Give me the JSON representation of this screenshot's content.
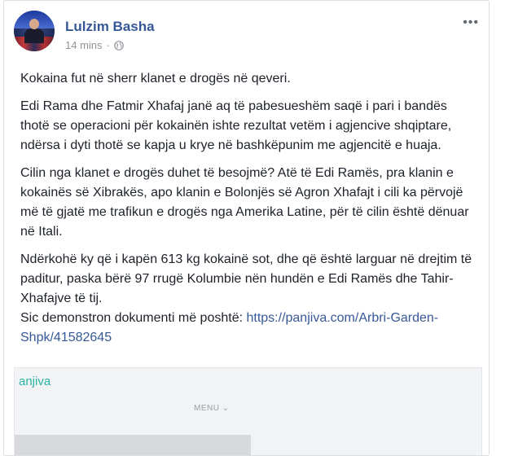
{
  "post": {
    "author": "Lulzim Basha",
    "time": "14 mins",
    "separator": "·",
    "privacy_icon": "globe-icon",
    "more_label": "•••",
    "paragraphs": [
      "Kokaina fut në sherr klanet e drogës në qeveri.",
      "Edi Rama dhe Fatmir Xhafaj janë aq të pabesueshëm saqë i pari i bandës thotë se operacioni për kokainën ishte rezultat vetëm i agjencive shqiptare, ndërsa i dyti thotë se kapja u kryе në bashkëpunim me agjencitë e huaja.",
      "Cilin nga klanet e drogës duhet të besojmë? Atë të Edi Ramës, pra klanin e kokainës së Xibrakës, apo klanin e Bolonjës së Agron Xhafajt i cili ka përvojë më të gjatë me trafikun e drogës nga Amerika Latine, për të cilin është dënuar në Itali.",
      "Ndërkohë ky që i kapën 613 kg kokainë sot, dhe që është larguar në drejtim të paditur, paska bërë 97 rrugë Kolumbie nën hundën e Edi Ramës dhe Tahir-Xhafajve të tij."
    ],
    "source_prefix": "Sic demonstron dokumenti më poshtë: ",
    "link_text": "https://panjiva.com/Arbri-Garden-Shpk/41582645"
  },
  "preview": {
    "logo_text": "anjiva",
    "menu_label": "MENU ⌄"
  },
  "colors": {
    "author": "#365899",
    "link": "#365899",
    "meta": "#90949c",
    "text": "#1d2129",
    "brand_teal": "#2ab3a6"
  }
}
